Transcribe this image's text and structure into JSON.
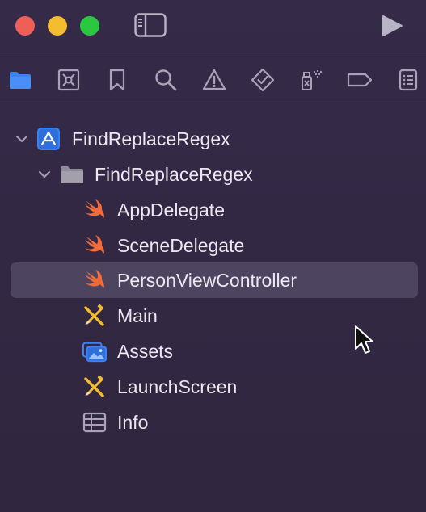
{
  "window": {
    "controls": [
      "close",
      "minimize",
      "zoom"
    ],
    "toolbar_icons": [
      "sidebar-toggle-icon",
      "play-icon"
    ]
  },
  "navigator_tabs": [
    {
      "name": "project-navigator",
      "icon": "folder-icon",
      "active": true
    },
    {
      "name": "source-control-navigator",
      "icon": "source-control-icon",
      "active": false
    },
    {
      "name": "bookmark-navigator",
      "icon": "bookmark-icon",
      "active": false
    },
    {
      "name": "find-navigator",
      "icon": "magnifier-icon",
      "active": false
    },
    {
      "name": "issue-navigator",
      "icon": "warning-icon",
      "active": false
    },
    {
      "name": "test-navigator",
      "icon": "diamond-check-icon",
      "active": false
    },
    {
      "name": "debug-navigator",
      "icon": "spray-icon",
      "active": false
    },
    {
      "name": "breakpoint-navigator",
      "icon": "tag-icon",
      "active": false
    },
    {
      "name": "report-navigator",
      "icon": "list-icon",
      "active": false
    }
  ],
  "colors": {
    "background": "#30263f",
    "accent": "#3b82f6",
    "selection": "#4d4560",
    "text": "#ebe8f0",
    "swift_orange": "#f26b3a"
  },
  "tree": {
    "project": {
      "label": "FindReplaceRegex",
      "icon": "xcode-project-icon",
      "expanded": true
    },
    "group": {
      "label": "FindReplaceRegex",
      "icon": "folder-icon",
      "expanded": true
    },
    "files": [
      {
        "label": "AppDelegate",
        "icon": "swift-icon",
        "selected": false
      },
      {
        "label": "SceneDelegate",
        "icon": "swift-icon",
        "selected": false
      },
      {
        "label": "PersonViewController",
        "icon": "swift-icon",
        "selected": true
      },
      {
        "label": "Main",
        "icon": "storyboard-icon",
        "selected": false
      },
      {
        "label": "Assets",
        "icon": "asset-catalog-icon",
        "selected": false
      },
      {
        "label": "LaunchScreen",
        "icon": "storyboard-icon",
        "selected": false
      },
      {
        "label": "Info",
        "icon": "plist-icon",
        "selected": false
      }
    ]
  }
}
